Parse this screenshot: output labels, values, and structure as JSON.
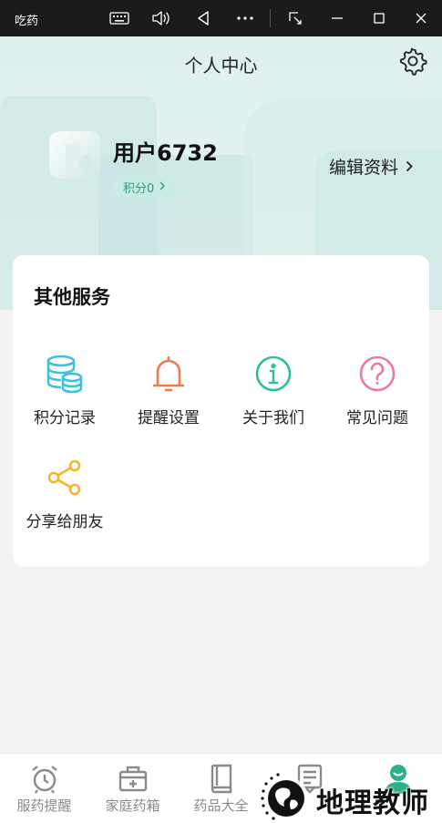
{
  "window": {
    "app_title": "吃药"
  },
  "header": {
    "title": "个人中心",
    "user_name": "用户6732",
    "points_label": "积分0",
    "edit_profile_label": "编辑资料"
  },
  "services": {
    "title": "其他服务",
    "items": [
      {
        "label": "积分记录",
        "icon": "database-icon",
        "color": "#3cc2e0"
      },
      {
        "label": "提醒设置",
        "icon": "bell-icon",
        "color": "#f07a4a"
      },
      {
        "label": "关于我们",
        "icon": "info-icon",
        "color": "#2bc29a"
      },
      {
        "label": "常见问题",
        "icon": "help-icon",
        "color": "#ee7aa0"
      },
      {
        "label": "分享给朋友",
        "icon": "share-icon",
        "color": "#f4b62a"
      }
    ]
  },
  "bottom_nav": {
    "items": [
      {
        "label": "服药提醒",
        "icon": "alarm-clock-icon",
        "active": false
      },
      {
        "label": "家庭药箱",
        "icon": "medicine-box-icon",
        "active": false
      },
      {
        "label": "药品大全",
        "icon": "book-icon",
        "active": false
      },
      {
        "label": "",
        "icon": "document-icon",
        "active": false
      },
      {
        "label": "",
        "icon": "user-icon",
        "active": true
      }
    ]
  },
  "watermark": {
    "text": "地理教师"
  },
  "colors": {
    "accent": "#2bb089",
    "titlebar": "#1b1b1b",
    "pill_bg": "#c8ece4"
  }
}
